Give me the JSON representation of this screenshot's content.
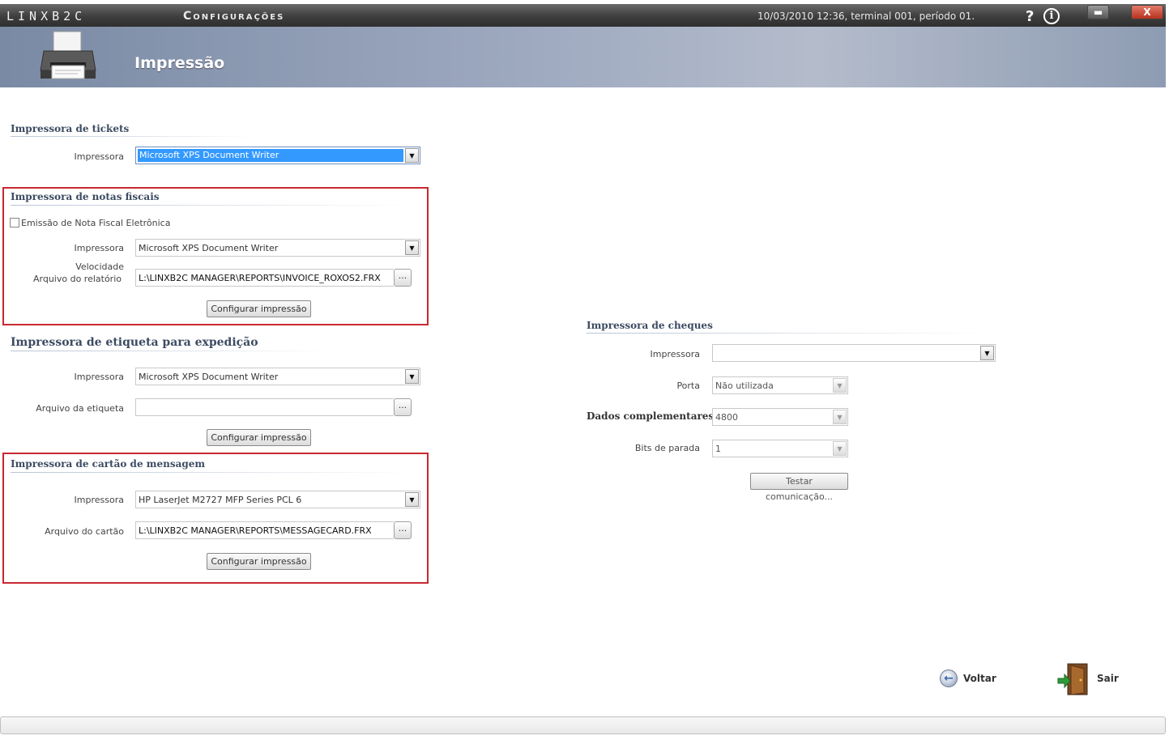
{
  "titlebar": {
    "logo": "LINXB2C",
    "section": "Configurações",
    "status": "10/03/2010 12:36, terminal 001, período 01.",
    "help": "?",
    "info": "i",
    "minimize": "▬",
    "close": "X"
  },
  "header": {
    "title": "Impressão",
    "icon": "printer-icon"
  },
  "tickets": {
    "legend": "Impressora de tickets",
    "printer_label": "Impressora",
    "printer_value": "Microsoft XPS Document Writer"
  },
  "fiscal": {
    "legend": "Impressora de notas fiscais",
    "nfe_checkbox_label": "Emissão de Nota Fiscal Eletrônica",
    "nfe_checked": false,
    "printer_label": "Impressora",
    "printer_value": "Microsoft XPS Document Writer",
    "speed_label": "Velocidade",
    "report_label": "Arquivo do relatório",
    "report_value": "L:\\LINXB2C MANAGER\\REPORTS\\INVOICE_ROXOS2.FRX",
    "browse": "...",
    "config_button": "Configurar impressão"
  },
  "shipping": {
    "legend": "Impressora de etiqueta para expedição",
    "printer_label": "Impressora",
    "printer_value": "Microsoft XPS Document Writer",
    "label_file_label": "Arquivo da etiqueta",
    "label_file_value": "",
    "browse": "...",
    "config_button": "Configurar impressão"
  },
  "message_card": {
    "legend": "Impressora de cartão de mensagem",
    "printer_label": "Impressora",
    "printer_value": "HP LaserJet M2727 MFP Series PCL 6",
    "card_file_label": "Arquivo do cartão",
    "card_file_value": "L:\\LINXB2C MANAGER\\REPORTS\\MESSAGECARD.FRX",
    "browse": "...",
    "config_button": "Configurar impressão"
  },
  "cheques": {
    "legend": "Impressora de cheques",
    "printer_label": "Impressora",
    "printer_value": "",
    "port_label": "Porta",
    "port_value": "Não utilizada",
    "extra_label": "Dados complementares",
    "extra_value": "4800",
    "stopbits_label": "Bits de parada",
    "stopbits_value": "1",
    "test_button": "Testar comunicação..."
  },
  "footer": {
    "back_label": "Voltar",
    "exit_label": "Sair"
  },
  "arrow_glyph": "▼"
}
